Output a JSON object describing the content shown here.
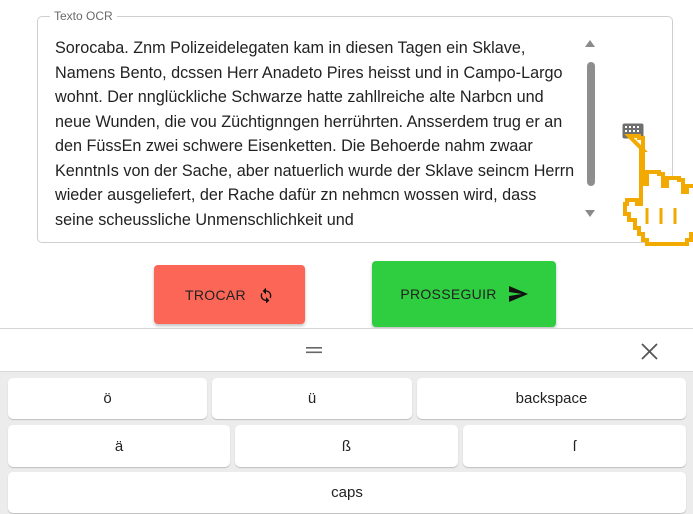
{
  "ocr": {
    "legend": "Texto OCR",
    "text": "Sorocaba. Znm Polizeidelegaten kam in diesen Tagen ein Sklave, Namens Bento, dcssen Herr Anadeto Pires heisst und in Campo-Largo wohnt. Der nnglückliche Schwarze hatte zahllreiche alte Narbcn und neue Wunden, die vou Züchtignngen herrührten. Ansserdem trug er an den FüssEn zwei schwere Eisenketten. Die Behoerde nahm zwaar KenntnIs von der Sache, aber natuerlich wurde der Sklave seincm Herrn wieder ausgeliefert, der Rache dafür zn nehmcn wossen wird, dass seine scheussliche Unmenschlichkeit und"
  },
  "actions": {
    "swap_label": "TROCAR",
    "continue_label": "PROSSEGUIR"
  },
  "keyboard": {
    "row1": [
      "ö",
      "ü",
      "backspace"
    ],
    "row2": [
      "ä",
      "ß",
      "ſ"
    ],
    "row3": [
      "caps"
    ]
  },
  "colors": {
    "swap_button": "#fb6656",
    "continue_button": "#2fce40",
    "cursor_outline": "#f2a900"
  },
  "icons": [
    "refresh-icon",
    "send-icon",
    "keyboard-icon",
    "hand-pointer-icon",
    "drag-handle-icon",
    "close-icon"
  ]
}
